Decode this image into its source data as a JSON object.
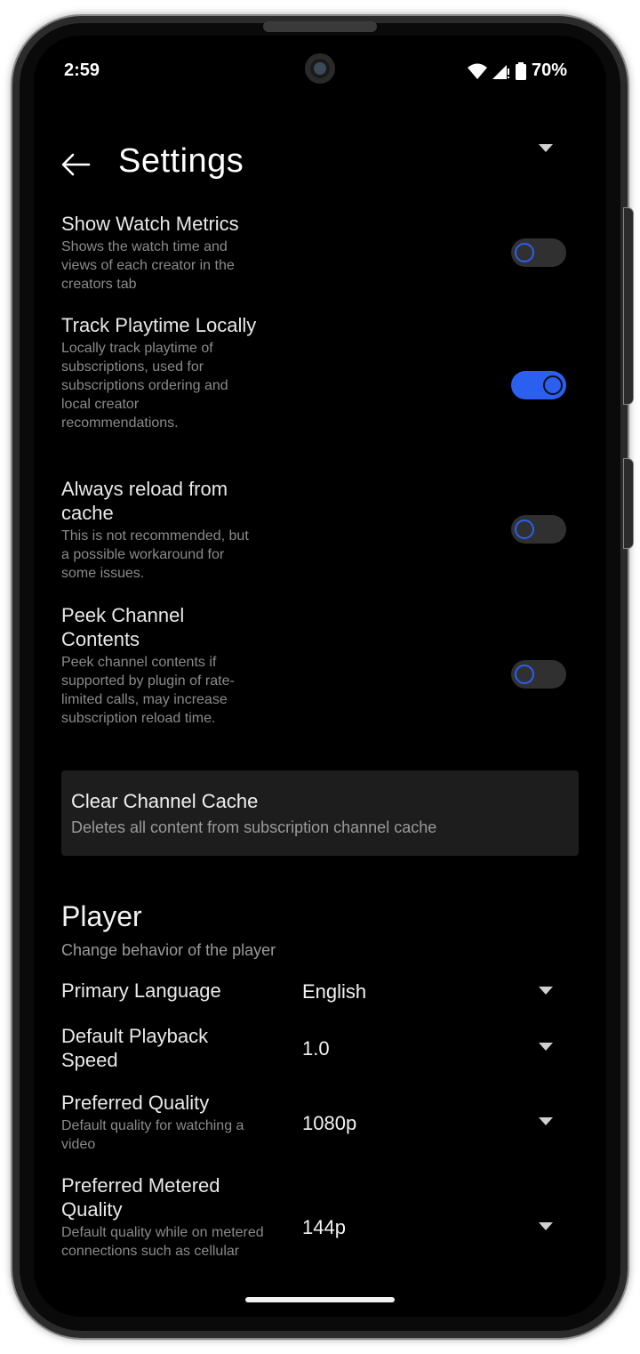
{
  "status": {
    "time": "2:59",
    "battery": "70%"
  },
  "header": {
    "title": "Settings"
  },
  "settings": [
    {
      "title": "Show Watch Metrics",
      "desc": "Shows the watch time and views of each creator in the creators tab",
      "on": false
    },
    {
      "title": "Track Playtime Locally",
      "desc": "Locally track playtime of subscriptions, used for subscriptions ordering and local creator recommendations.",
      "on": true
    },
    {
      "title": "Always reload from cache",
      "desc": "This is not recommended, but a possible workaround for some issues.",
      "on": false
    },
    {
      "title": "Peek Channel Contents",
      "desc": "Peek channel contents if supported by plugin of rate-limited calls, may increase subscription reload time.",
      "on": false
    }
  ],
  "clear_cache": {
    "title": "Clear Channel Cache",
    "desc": "Deletes all content from subscription channel cache"
  },
  "player": {
    "title": "Player",
    "desc": "Change behavior of the player",
    "dropdowns": [
      {
        "label": "Primary Language",
        "desc": "",
        "value": "English"
      },
      {
        "label": "Default Playback Speed",
        "desc": "",
        "value": "1.0"
      },
      {
        "label": "Preferred Quality",
        "desc": "Default quality for watching a video",
        "value": "1080p"
      },
      {
        "label": "Preferred Metered Quality",
        "desc": "Default quality while on metered connections such as cellular",
        "value": "144p"
      }
    ]
  },
  "colors": {
    "accent": "#2a5ff0",
    "background": "#000000",
    "card": "#1d1d1d"
  }
}
